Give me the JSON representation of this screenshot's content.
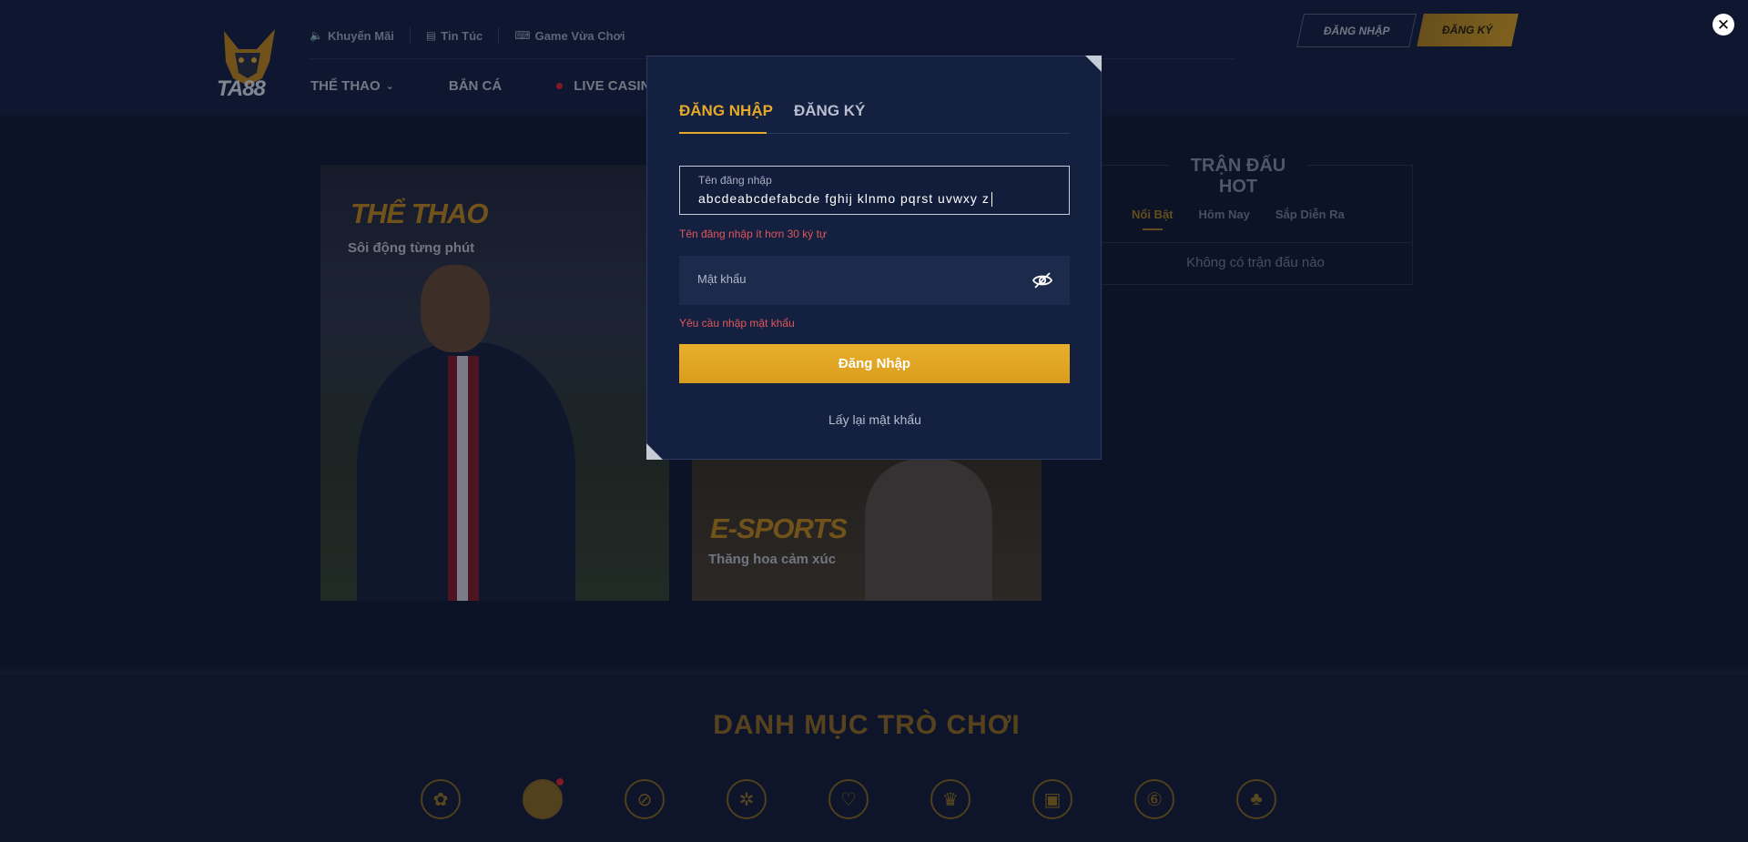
{
  "header": {
    "logo_text": "TA88",
    "top_links": [
      {
        "label": "Khuyến Mãi",
        "icon": "speaker-icon"
      },
      {
        "label": "Tin Túc",
        "icon": "document-icon"
      },
      {
        "label": "Game Vừa Chơi",
        "icon": "gamepad-icon"
      }
    ],
    "main_nav": [
      "THỂ THAO",
      "BẮN CÁ",
      "LIVE CASINO"
    ],
    "login_button": "ĐĂNG NHẬP",
    "register_button": "ĐĂNG KÝ"
  },
  "cards": {
    "sports": {
      "title": "THỂ THAO",
      "subtitle": "Sôi động từng phút"
    },
    "esports": {
      "title": "E-SPORTS",
      "subtitle": "Thăng hoa cảm xúc"
    }
  },
  "hot_matches": {
    "title": "TRẬN ĐẤU HOT",
    "tabs": [
      "Nổi Bật",
      "Hôm Nay",
      "Sắp Diễn Ra"
    ],
    "empty": "Không có trận đấu nào"
  },
  "categories": {
    "title": "DANH MỤC TRÒ CHƠI"
  },
  "modal": {
    "tab_login": "ĐĂNG NHẬP",
    "tab_register": "ĐĂNG KÝ",
    "username_label": "Tên đăng nhập",
    "username_value": "abcdeabcdefabcde fghij klnmo pqrst uvwxy z",
    "username_error": "Tên đăng nhập ít hơn 30 ký tự",
    "password_placeholder": "Mật khẩu",
    "password_error": "Yêu cầu nhập mật khẩu",
    "submit": "Đăng Nhập",
    "forgot": "Lấy lại mật khẩu"
  },
  "colors": {
    "accent": "#e5a92a",
    "error": "#e2565c",
    "background": "#111a33"
  }
}
